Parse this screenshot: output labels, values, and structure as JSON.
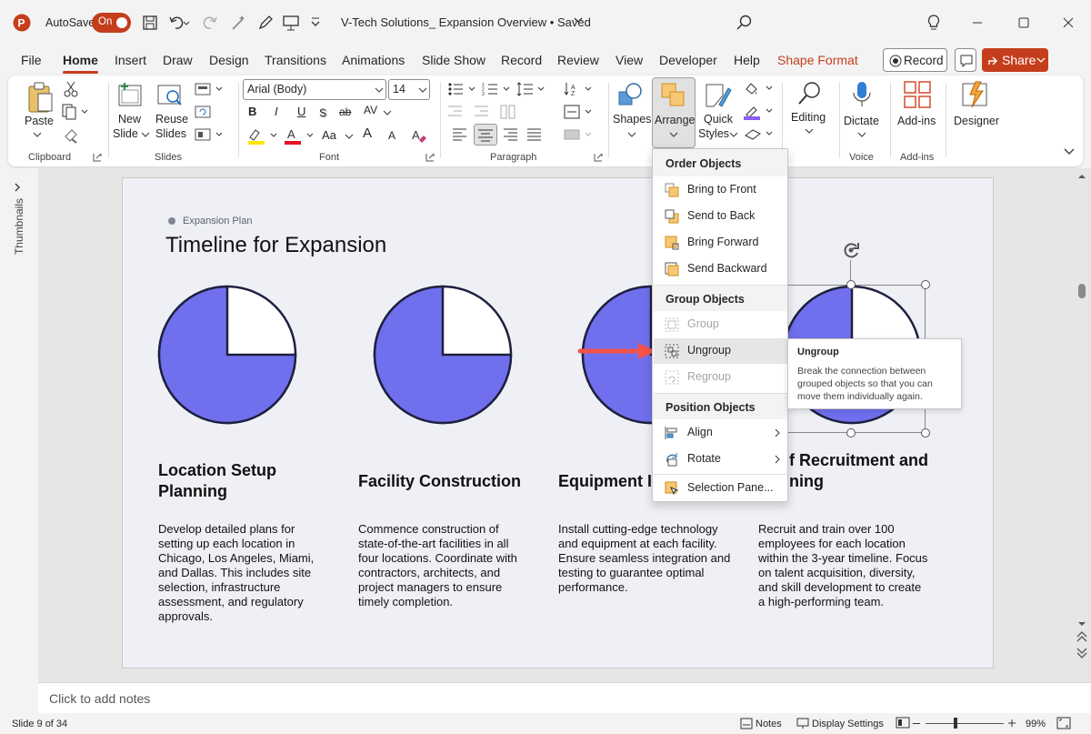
{
  "titlebar": {
    "autosave_label": "AutoSave",
    "autosave_state": "On",
    "doc_title": "V-Tech Solutions_ Expansion Overview • Saved",
    "app_icon": "powerpoint-logo-icon"
  },
  "tabs": [
    "File",
    "Home",
    "Insert",
    "Draw",
    "Design",
    "Transitions",
    "Animations",
    "Slide Show",
    "Record",
    "Review",
    "View",
    "Developer",
    "Help",
    "Shape Format"
  ],
  "active_tab": "Home",
  "ribbon_right": {
    "record": "Record",
    "share": "Share"
  },
  "ribbon": {
    "clipboard": {
      "paste": "Paste",
      "group": "Clipboard"
    },
    "slides": {
      "new_slide": "New",
      "new_slide2": "Slide",
      "reuse": "Reuse",
      "reuse2": "Slides",
      "group": "Slides"
    },
    "font": {
      "font_name": "Arial (Body)",
      "font_size": "14",
      "group": "Font",
      "bold": "B",
      "italic": "I",
      "underline": "U",
      "strike": "ab",
      "spacing": "AV",
      "case": "Aa",
      "grow": "A",
      "shrink": "A"
    },
    "paragraph": {
      "group": "Paragraph"
    },
    "drawing": {
      "shapes": "Shapes",
      "arrange": "Arrange",
      "quick1": "Quick",
      "quick2": "Styles"
    },
    "editing": {
      "label": "Editing"
    },
    "voice": {
      "dictate": "Dictate",
      "group": "Voice"
    },
    "addins": {
      "label": "Add-ins",
      "group": "Add-ins"
    },
    "designer": {
      "label": "Designer"
    }
  },
  "thumbnails_label": "Thumbnails",
  "slide": {
    "kicker": "Expansion Plan",
    "title": "Timeline for Expansion",
    "columns": [
      {
        "title_l1": "Location Setup",
        "title_l2": "Planning",
        "body": [
          "Develop detailed plans for",
          "setting up each location in",
          "Chicago, Los Angeles, Miami,",
          "and Dallas. This includes site",
          "selection, infrastructure",
          "assessment, and regulatory",
          "approvals."
        ]
      },
      {
        "title_l1": "Facility Construction",
        "title_l2": "",
        "body": [
          "Commence construction of",
          "state-of-the-art facilities in all",
          "four locations. Coordinate with",
          "contractors, architects, and",
          "project managers to ensure",
          "timely completion."
        ]
      },
      {
        "title_l1": "Equipment In",
        "title_l2": "",
        "body": [
          "Install cutting-edge technology",
          "and equipment at each facility.",
          "Ensure seamless integration and",
          "testing to guarantee optimal",
          "performance."
        ]
      },
      {
        "title_l1": "f Recruitment and",
        "title_l2": "ning",
        "body": [
          "Recruit and train over 100",
          "employees for each location",
          "within the 3-year timeline. Focus",
          "on talent acquisition, diversity,",
          "and skill development to create",
          "a high-performing team."
        ]
      }
    ],
    "pie_fill_fraction": 0.75,
    "pie_color": "#7070ee"
  },
  "menu": {
    "order_head": "Order Objects",
    "bring_front": "Bring to Front",
    "send_back": "Send to Back",
    "bring_forward": "Bring Forward",
    "send_backward": "Send Backward",
    "group_head": "Group Objects",
    "group": "Group",
    "ungroup": "Ungroup",
    "regroup": "Regroup",
    "position_head": "Position Objects",
    "align": "Align",
    "rotate": "Rotate",
    "selection_pane": "Selection Pane..."
  },
  "tooltip": {
    "title": "Ungroup",
    "l1": "Break the connection between",
    "l2": "grouped objects so that you can",
    "l3": "move them individually again."
  },
  "notes_placeholder": "Click to add notes",
  "status": {
    "slide_info": "Slide 9 of 34",
    "notes": "Notes",
    "display": "Display Settings",
    "zoom": "99%"
  },
  "colors": {
    "accent": "#c43e1c",
    "pie": "#7070ee",
    "arrow": "#f4534a"
  }
}
